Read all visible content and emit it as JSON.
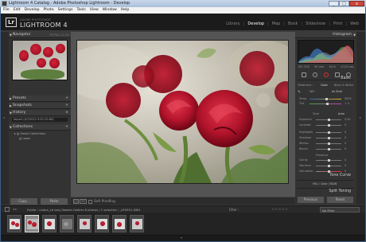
{
  "window": {
    "title": "Lightroom 4 Catalog - Adobe Photoshop Lightroom - Develop",
    "minimize": "_",
    "maximize": "□",
    "close": "x"
  },
  "menu": [
    "File",
    "Edit",
    "Develop",
    "Photo",
    "Settings",
    "Tools",
    "View",
    "Window",
    "Help"
  ],
  "brand": {
    "logo": "Lr",
    "sub": "ADOBE PHOTOSHOP",
    "name": "LIGHTROOM 4"
  },
  "modules": [
    "Library",
    "Develop",
    "Map",
    "Book",
    "Slideshow",
    "Print",
    "Web"
  ],
  "active_module": "Develop",
  "left_panel": {
    "navigator": "Navigator",
    "navigator_modes": "FIT  FILL  1:1  3:1",
    "presets": "Presets",
    "snapshots": "Snapshots",
    "history": "History",
    "history_item": "Import (4/7/2012 9:52:23 AM)",
    "collections": "Collections",
    "collection_items": [
      "Smart Collections",
      "roses"
    ],
    "copy": "Copy...",
    "paste": "Paste"
  },
  "toolbar": {
    "soft_proofing": "Soft Proofing"
  },
  "right_panel": {
    "histogram": "Histogram",
    "hist_info": [
      "ISO 200",
      "50 mm",
      "f/5.6",
      "1/125 sec"
    ],
    "basic": "Basic",
    "treatment_label": "Treatment :",
    "treatment_color": "Color",
    "treatment_bw": "Black & White",
    "wb_label": "WB :",
    "wb_value": "As Shot",
    "temp_label": "Temp",
    "temp_value": "5000",
    "tint_label": "Tint",
    "tint_value": "+ 4",
    "tone": "Tone",
    "tone_auto": "Auto",
    "tone_sliders": [
      "Exposure",
      "Contrast",
      "Highlights",
      "Shadows",
      "Whites",
      "Blacks"
    ],
    "tone_values": [
      "0.00",
      "0",
      "0",
      "0",
      "0",
      "0"
    ],
    "presence": "Presence",
    "presence_sliders": [
      "Clarity",
      "Vibrance",
      "Saturation"
    ],
    "presence_values": [
      "0",
      "0",
      "0"
    ],
    "tone_curve": "Tone Curve",
    "hsl_tabs": "HSL / Color / B&W",
    "split_toning": "Split Toning",
    "previous": "Previous",
    "reset": "Reset"
  },
  "filmstrip": {
    "path": "Folder : colors_cd and_flowers folders   8 photos / 1 selected / _LR3951.DNG",
    "filter_label": "Filter :",
    "stars": "☆☆☆☆☆",
    "filter_value": "No Filter",
    "thumbs": 8,
    "selected_index": 1
  },
  "colors": {
    "accent_red": "#b0152a",
    "panel": "#333333",
    "titlebar": "#b7cae1"
  }
}
